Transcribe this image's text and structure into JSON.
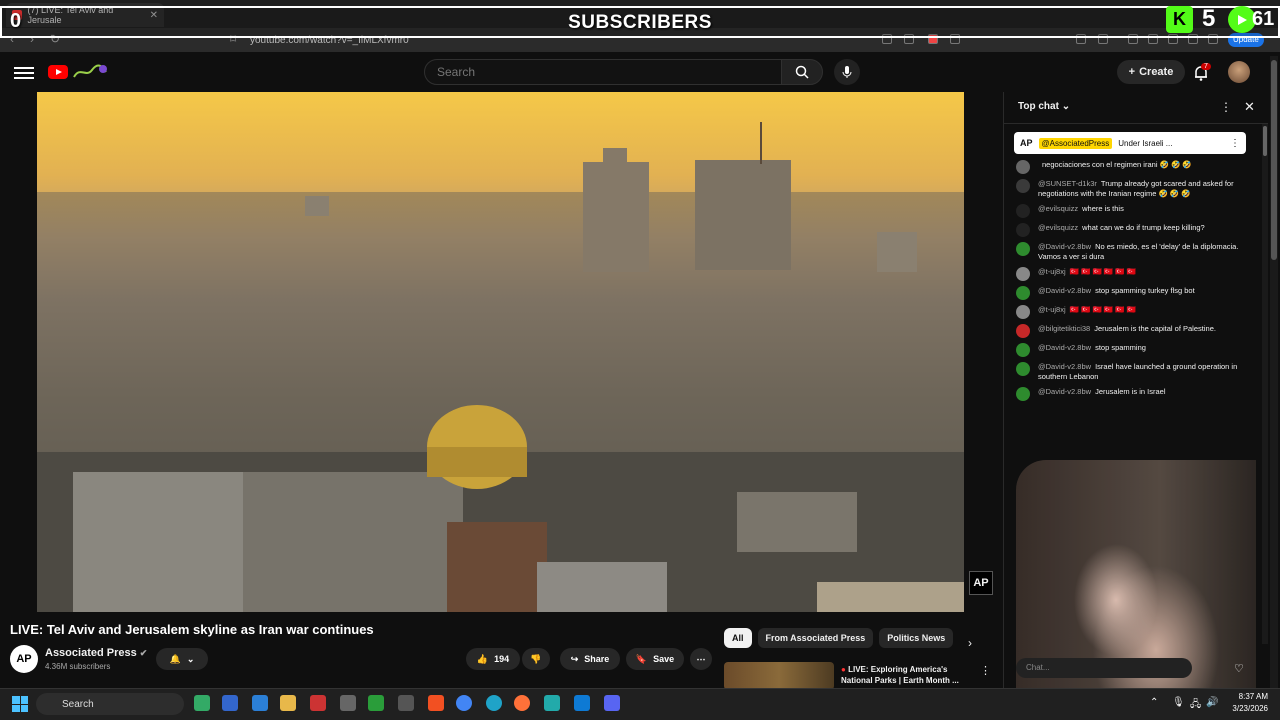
{
  "browser": {
    "tab_title": "(7) LIVE: Tel Aviv and Jerusale",
    "url": "youtube.com/watch?v=_IiMLXfvmr0",
    "update_label": "Update"
  },
  "overlay": {
    "sub_count": "0",
    "label": "SUBSCRIBERS",
    "kick_count": "5",
    "rumble_count": "61"
  },
  "header": {
    "search_placeholder": "Search",
    "create_label": "Create",
    "notifications": "7"
  },
  "video": {
    "watermark": "AP",
    "title": "LIVE: Tel Aviv and Jerusalem skyline as Iran war continues",
    "channel": "Associated Press",
    "subscribers": "4.36M subscribers",
    "likes": "194",
    "share_label": "Share",
    "save_label": "Save"
  },
  "chips": [
    "All",
    "From Associated Press",
    "Politics News"
  ],
  "recommendation": {
    "title": "LIVE: Exploring America's National Parks | Earth Month ..."
  },
  "chat": {
    "header": "Top chat",
    "pinned_author": "@AssociatedPress",
    "pinned_text": "Under Israeli ...",
    "input_placeholder": "Chat...",
    "messages": [
      {
        "author": "",
        "text": "negociaciones con el regimen irani 🤣 🤣 🤣",
        "color": "#666"
      },
      {
        "author": "@SUNSET-d1k3r",
        "text": "Trump already got scared and asked for negotiations with the Iranian regime 🤣 🤣 🤣",
        "color": "#3a3a3a"
      },
      {
        "author": "@evilsquizz",
        "text": "where is this",
        "color": "#222"
      },
      {
        "author": "@evilsquizz",
        "text": "what can we do if trump keep killing?",
        "color": "#222"
      },
      {
        "author": "@David-v2.8bw",
        "text": "No es miedo, es el 'delay' de la diplomacia. Vamos a ver si dura",
        "color": "#2e8b2e"
      },
      {
        "author": "@t-uj8xj",
        "text": "🇹🇷 🇹🇷 🇹🇷 🇹🇷 🇹🇷 🇹🇷",
        "color": "#888"
      },
      {
        "author": "@David-v2.8bw",
        "text": "stop spamming turkey flsg bot",
        "color": "#2e8b2e"
      },
      {
        "author": "@t-uj8xj",
        "text": "🇹🇷 🇹🇷 🇹🇷 🇹🇷 🇹🇷 🇹🇷",
        "color": "#888"
      },
      {
        "author": "@bilgitetiktici38",
        "text": "Jerusalem is the capital of Palestine.",
        "color": "#c62828"
      },
      {
        "author": "@David-v2.8bw",
        "text": "stop spamming",
        "color": "#2e8b2e"
      },
      {
        "author": "@David-v2.8bw",
        "text": "Israel have launched a ground operation in southern Lebanon",
        "color": "#2e8b2e"
      },
      {
        "author": "@David-v2.8bw",
        "text": "Jerusalem is in Israel",
        "color": "#2e8b2e"
      }
    ]
  },
  "taskbar": {
    "search_label": "Search",
    "time": "8:37 AM",
    "date": "3/23/2026"
  }
}
